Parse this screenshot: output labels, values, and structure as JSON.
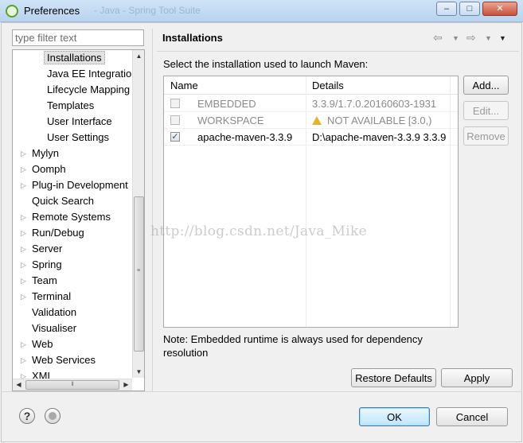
{
  "window": {
    "title": "Preferences",
    "blurred_title": "- Java - Spring Tool Suite",
    "minimize": "–",
    "maximize": "□",
    "close": "✕",
    "app_icon": "eclipse-icon"
  },
  "sidebar": {
    "filter_placeholder": "type filter text",
    "items": [
      {
        "label": "Installations",
        "level": 2,
        "expandable": false,
        "selected": true
      },
      {
        "label": "Java EE Integration",
        "level": 2,
        "expandable": false
      },
      {
        "label": "Lifecycle Mapping",
        "level": 2,
        "expandable": false
      },
      {
        "label": "Templates",
        "level": 2,
        "expandable": false
      },
      {
        "label": "User Interface",
        "level": 2,
        "expandable": false
      },
      {
        "label": "User Settings",
        "level": 2,
        "expandable": false
      },
      {
        "label": "Mylyn",
        "level": 1,
        "expandable": true
      },
      {
        "label": "Oomph",
        "level": 1,
        "expandable": true
      },
      {
        "label": "Plug-in Development",
        "level": 1,
        "expandable": true
      },
      {
        "label": "Quick Search",
        "level": 1,
        "expandable": false
      },
      {
        "label": "Remote Systems",
        "level": 1,
        "expandable": true
      },
      {
        "label": "Run/Debug",
        "level": 1,
        "expandable": true
      },
      {
        "label": "Server",
        "level": 1,
        "expandable": true
      },
      {
        "label": "Spring",
        "level": 1,
        "expandable": true
      },
      {
        "label": "Team",
        "level": 1,
        "expandable": true
      },
      {
        "label": "Terminal",
        "level": 1,
        "expandable": true
      },
      {
        "label": "Validation",
        "level": 1,
        "expandable": false
      },
      {
        "label": "Visualiser",
        "level": 1,
        "expandable": false
      },
      {
        "label": "Web",
        "level": 1,
        "expandable": true
      },
      {
        "label": "Web Services",
        "level": 1,
        "expandable": true
      },
      {
        "label": "XML",
        "level": 1,
        "expandable": true
      }
    ]
  },
  "main": {
    "title": "Installations",
    "description": "Select the installation used to launch Maven:",
    "columns": [
      "Name",
      "Details"
    ],
    "rows": [
      {
        "checked": false,
        "enabled": false,
        "name": "EMBEDDED",
        "details": "3.3.9/1.7.0.20160603-1931",
        "warning": false
      },
      {
        "checked": false,
        "enabled": false,
        "name": "WORKSPACE",
        "details": "NOT AVAILABLE [3.0,)",
        "warning": true
      },
      {
        "checked": true,
        "enabled": true,
        "name": "apache-maven-3.3.9",
        "details": "D:\\apache-maven-3.3.9 3.3.9",
        "warning": false
      }
    ],
    "buttons": {
      "add": "Add...",
      "edit": "Edit...",
      "remove": "Remove"
    },
    "note": "Note: Embedded runtime is always used for dependency resolution",
    "restore_defaults": "Restore Defaults",
    "apply": "Apply"
  },
  "footer": {
    "ok": "OK",
    "cancel": "Cancel"
  },
  "watermark": "http://blog.csdn.net/Java_Mike"
}
